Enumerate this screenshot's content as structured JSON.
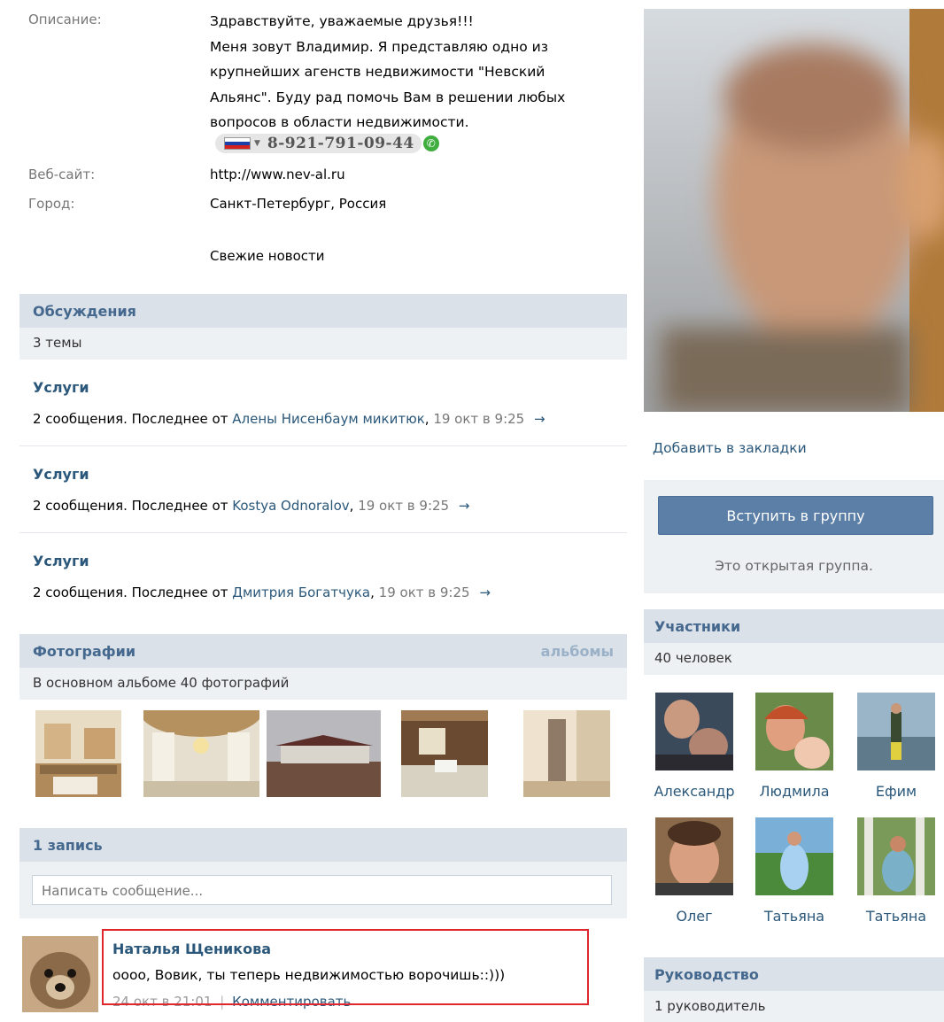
{
  "info": {
    "description_label": "Описание:",
    "description_lines": [
      "Здравствуйте, уважаемые друзья!!!",
      "Меня зовут Владимир. Я представляю одно из",
      "крупнейших агенств недвижимости \"Невский",
      "Альянс\". Буду рад помочь Вам в решении любых",
      "вопросов в области недвижимости."
    ],
    "phone": "8-921-791-09-44",
    "website_label": "Веб-сайт:",
    "website": "http://www.nev-al.ru",
    "city_label": "Город:",
    "city": "Санкт-Петербург, Россия",
    "news_link": "Свежие новости"
  },
  "discussions": {
    "title": "Обсуждения",
    "count": "3 темы",
    "topics": [
      {
        "title": "Услуги",
        "prefix": "2 сообщения. Последнее от ",
        "author": "Алены Нисенбаум микитюк",
        "date": "19 окт в 9:25"
      },
      {
        "title": "Услуги",
        "prefix": "2 сообщения. Последнее от ",
        "author": "Kostya Odnoralov",
        "date": "19 окт в 9:25"
      },
      {
        "title": "Услуги",
        "prefix": "2 сообщения. Последнее от ",
        "author": "Дмитрия Богатчука",
        "date": "19 окт в 9:25"
      }
    ],
    "arrow": "→"
  },
  "photos": {
    "title": "Фотографии",
    "albums_link": "альбомы",
    "summary": "В основном альбоме 40 фотографий"
  },
  "wall": {
    "title": "1 запись",
    "input_placeholder": "Написать сообщение...",
    "post": {
      "author": "Наталья Щеникова",
      "text": "оооо, Вовик, ты теперь недвижимостью ворочишь::)))",
      "date": "24 окт в 21:01",
      "separator": "|",
      "comment_link": "Комментировать"
    }
  },
  "sidebar": {
    "bookmark_link": "Добавить в закладки",
    "join_button": "Вступить в группу",
    "open_group_note": "Это открытая группа.",
    "members_title": "Участники",
    "members_count": "40 человек",
    "members": [
      {
        "name": "Александр"
      },
      {
        "name": "Людмила"
      },
      {
        "name": "Ефим"
      },
      {
        "name": "Олег"
      },
      {
        "name": "Татьяна"
      },
      {
        "name": "Татьяна"
      }
    ],
    "management_title": "Руководство",
    "management_count": "1 руководитель"
  },
  "colors": {
    "link": "#2b587a",
    "header_bar": "#dae1e8",
    "join_button": "#5b7fa6",
    "highlight_box": "#e0262e"
  }
}
